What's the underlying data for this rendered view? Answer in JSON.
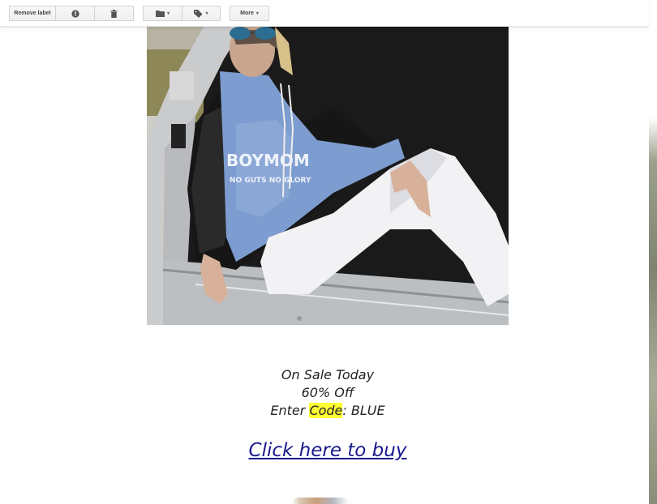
{
  "toolbar": {
    "remove_label": "Remove label",
    "report_spam_icon": "exclamation-icon",
    "delete_icon": "trash-icon",
    "move_to_icon": "folder-icon",
    "labels_icon": "tag-icon",
    "more_label": "More"
  },
  "email": {
    "sale_line1": "On Sale Today",
    "sale_line2": "60% Off",
    "code_prefix": "Enter ",
    "code_word": "Code",
    "code_suffix": ": BLUE",
    "buy_link": "Click here to buy",
    "shirt_line1": "BOYMOM",
    "shirt_line2": "NO GUTS NO GLORY",
    "highlight_color": "#ffff33",
    "link_color": "#1a1a8c"
  }
}
